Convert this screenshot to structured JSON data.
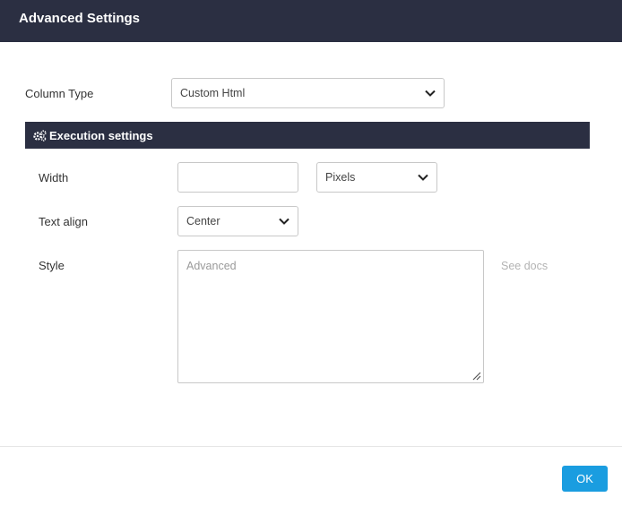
{
  "dialog": {
    "title": "Advanced Settings"
  },
  "column_type": {
    "label": "Column Type",
    "value": "Custom Html"
  },
  "section": {
    "icon": "gears-icon",
    "title": "Execution settings"
  },
  "width": {
    "label": "Width",
    "value": "",
    "unit": "Pixels"
  },
  "text_align": {
    "label": "Text align",
    "value": "Center"
  },
  "style": {
    "label": "Style",
    "placeholder": "Advanced",
    "docs_link": "See docs"
  },
  "footer": {
    "ok_label": "OK"
  },
  "colors": {
    "header": "#2b2f42",
    "accent": "#1a9de0"
  }
}
